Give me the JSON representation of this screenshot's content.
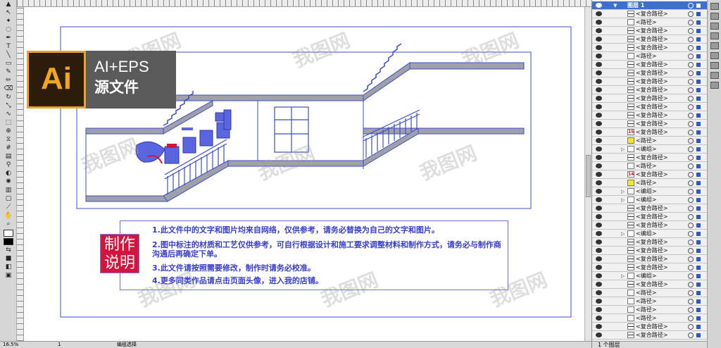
{
  "app": {
    "name": "Adobe Illustrator"
  },
  "badge": {
    "logo_text": "Ai",
    "title": "AI+EPS",
    "subtitle": "源文件",
    "accent": "#f2a620"
  },
  "note": {
    "stamp_line1": "制作",
    "stamp_line2": "说明",
    "lines": [
      "1.此文件中的文字和图片均来自网络，仅供参考，请务必替换为自己的文字和图片。",
      "2.图中标注的材质和工艺仅供参考，可自行根据设计和施工要求调整材料和制作方式，请务必与制作商沟通后再确定下单。",
      "3.此文件请按照需要修改，制作时请务必校准。",
      "4.更多同类作品请点击页面头像，进入我的店铺。"
    ]
  },
  "watermark": {
    "text": "我图网"
  },
  "layers": {
    "top_layer": "图层 1",
    "rows": [
      {
        "label": "<复合路径>",
        "thumb": "line"
      },
      {
        "label": "<路径>",
        "thumb": "blank"
      },
      {
        "label": "<复合路径>",
        "thumb": "line"
      },
      {
        "label": "<复合路径>",
        "thumb": "line"
      },
      {
        "label": "<复合路径>",
        "thumb": "line"
      },
      {
        "label": "<路径>",
        "thumb": "blank"
      },
      {
        "label": "<复合路径>",
        "thumb": "line"
      },
      {
        "label": "<复合路径>",
        "thumb": "line"
      },
      {
        "label": "<复合路径>",
        "thumb": "line"
      },
      {
        "label": "<复合路径>",
        "thumb": "line"
      },
      {
        "label": "<复合路径>",
        "thumb": "line"
      },
      {
        "label": "<复合路径>",
        "thumb": "line"
      },
      {
        "label": "<复合路径>",
        "thumb": "line"
      },
      {
        "label": "<复合路径>",
        "thumb": "line"
      },
      {
        "label": "<复合路径>",
        "thumb": "num",
        "num": "15"
      },
      {
        "label": "<路径>",
        "thumb": "yellow"
      },
      {
        "label": "<编组>",
        "thumb": "group",
        "expand": true
      },
      {
        "label": "<复合路径>",
        "thumb": "line"
      },
      {
        "label": "<路径>",
        "thumb": "blank"
      },
      {
        "label": "<复合路径>",
        "thumb": "num",
        "num": "14"
      },
      {
        "label": "<路径>",
        "thumb": "yellow"
      },
      {
        "label": "<编组>",
        "thumb": "group",
        "expand": true
      },
      {
        "label": "<编组>",
        "thumb": "group",
        "expand": true
      },
      {
        "label": "<复合路径>",
        "thumb": "line"
      },
      {
        "label": "<复合路径>",
        "thumb": "line"
      },
      {
        "label": "<复合路径>",
        "thumb": "line"
      },
      {
        "label": "<编组>",
        "thumb": "group",
        "expand": true
      },
      {
        "label": "<复合路径>",
        "thumb": "line"
      },
      {
        "label": "<复合路径>",
        "thumb": "line"
      },
      {
        "label": "<复合路径>",
        "thumb": "line"
      },
      {
        "label": "<复合路径>",
        "thumb": "line"
      },
      {
        "label": "<编组>",
        "thumb": "group",
        "expand": true
      },
      {
        "label": "<复合路径>",
        "thumb": "line"
      },
      {
        "label": "<路径>",
        "thumb": "blank"
      },
      {
        "label": "<路径>",
        "thumb": "blank"
      },
      {
        "label": "<路径>",
        "thumb": "blank"
      },
      {
        "label": "<路径>",
        "thumb": "blank"
      },
      {
        "label": "<复合路径>",
        "thumb": "line"
      },
      {
        "label": "<复合路径>",
        "thumb": "line"
      }
    ],
    "footer": "1 个图层"
  },
  "status": {
    "zoom": "16.5%",
    "page": "1",
    "mode": "编组选择"
  },
  "colors": {
    "path_blue": "#3b4ccf",
    "stair_gray": "#a0a0a8",
    "red_accent": "#d4143c"
  }
}
